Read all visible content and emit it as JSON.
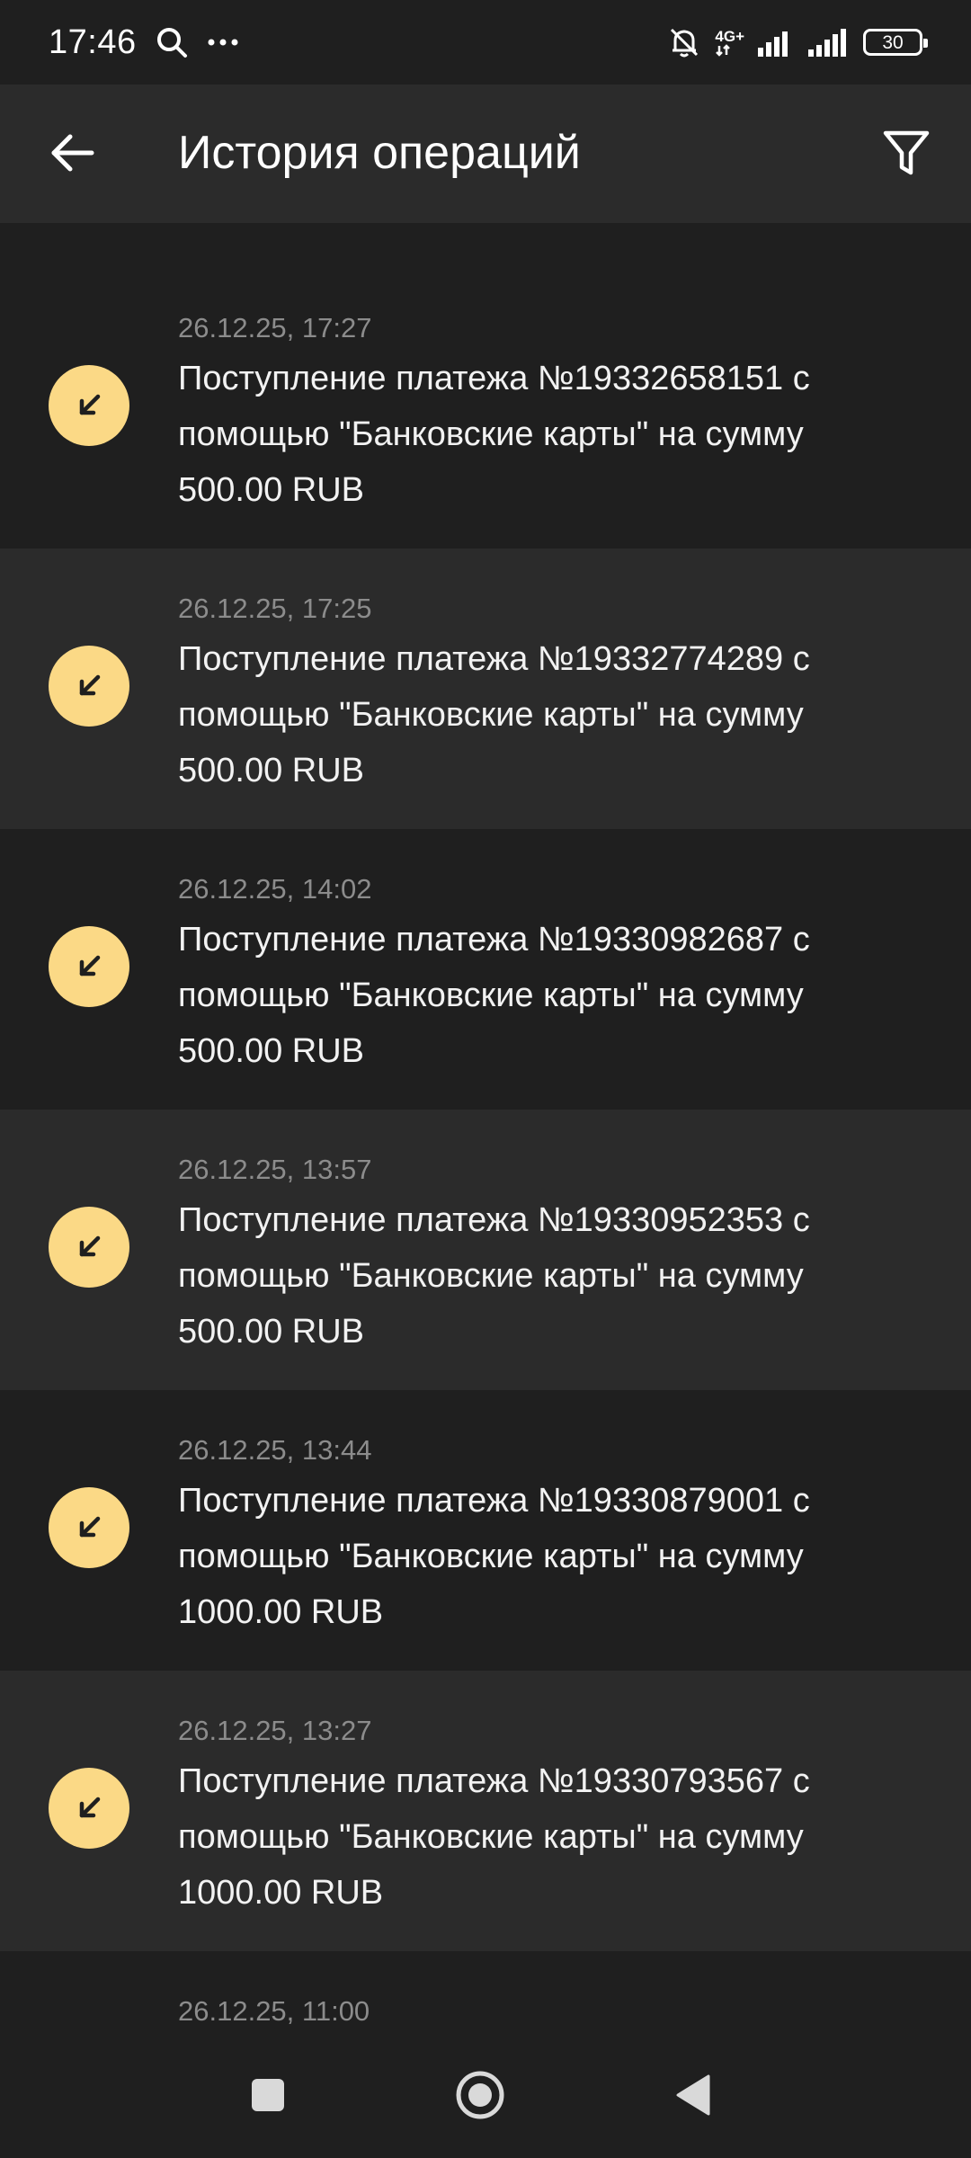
{
  "status_bar": {
    "time": "17:46",
    "network_label": "4G+",
    "battery_level": "30",
    "icons": [
      "search-icon",
      "more-icon",
      "bell-off-icon",
      "signal-icon",
      "battery-icon"
    ]
  },
  "header": {
    "title": "История операций",
    "back_icon": "arrow-left-icon",
    "filter_icon": "filter-icon"
  },
  "operations": [
    {
      "date": "26.12.25, 17:27",
      "description": "Поступление платежа №19332658151 с помощью \"Банковские карты\" на сумму 500.00 RUB",
      "icon": "incoming-arrow-icon"
    },
    {
      "date": "26.12.25, 17:25",
      "description": "Поступление платежа №19332774289 с помощью \"Банковские карты\" на сумму 500.00 RUB",
      "icon": "incoming-arrow-icon"
    },
    {
      "date": "26.12.25, 14:02",
      "description": "Поступление платежа №19330982687 с помощью \"Банковские карты\" на сумму 500.00 RUB",
      "icon": "incoming-arrow-icon"
    },
    {
      "date": "26.12.25, 13:57",
      "description": "Поступление платежа №19330952353 с помощью \"Банковские карты\" на сумму 500.00 RUB",
      "icon": "incoming-arrow-icon"
    },
    {
      "date": "26.12.25, 13:44",
      "description": "Поступление платежа №19330879001 с помощью \"Банковские карты\" на сумму 1000.00 RUB",
      "icon": "incoming-arrow-icon"
    },
    {
      "date": "26.12.25, 13:27",
      "description": "Поступление платежа №19330793567 с помощью \"Банковские карты\" на сумму 1000.00 RUB",
      "icon": "incoming-arrow-icon"
    },
    {
      "date": "26.12.25, 11:00",
      "description": "",
      "icon": "incoming-arrow-icon"
    }
  ],
  "nav_bar": {
    "icons": [
      "recents-square-icon",
      "home-circle-icon",
      "back-triangle-icon"
    ]
  },
  "colors": {
    "background": "#1f1f1f",
    "surface": "#2b2b2b",
    "accent_icon_bg": "#fbd986",
    "secondary_text": "#8c8c8c"
  }
}
